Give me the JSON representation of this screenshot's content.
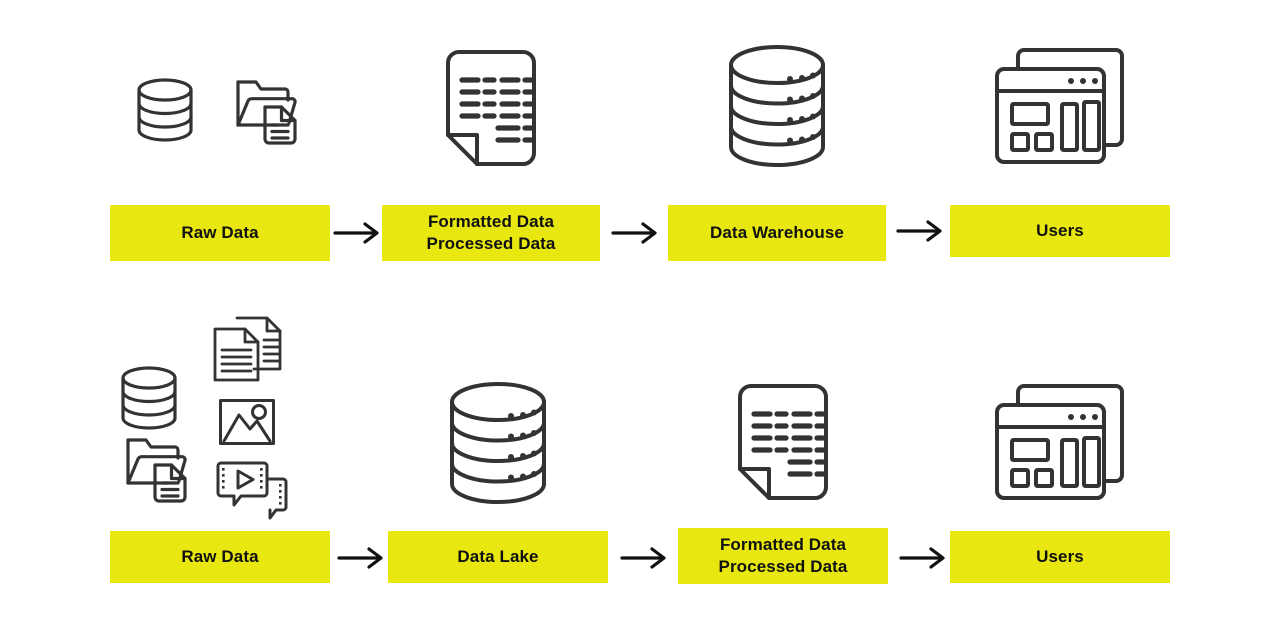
{
  "diagram": {
    "title": "Data Warehouse vs Data Lake pipeline comparison",
    "colors": {
      "highlight": "#e8e810",
      "stroke": "#333333",
      "text": "#111111",
      "background": "#ffffff"
    },
    "rows": [
      {
        "id": "data-warehouse-pipeline",
        "stages": [
          {
            "label": "Raw Data",
            "icons": [
              "database-icon",
              "folder-document-icon"
            ]
          },
          {
            "label": "Formatted Data\nProcessed Data",
            "icons": [
              "formatted-document-icon"
            ]
          },
          {
            "label": "Data Warehouse",
            "icons": [
              "data-warehouse-database-icon"
            ]
          },
          {
            "label": "Users",
            "icons": [
              "dashboard-windows-icon"
            ]
          }
        ],
        "arrows": [
          "arrow-right-icon",
          "arrow-right-icon",
          "arrow-right-icon"
        ]
      },
      {
        "id": "data-lake-pipeline",
        "stages": [
          {
            "label": "Raw Data",
            "icons": [
              "database-icon",
              "documents-stack-icon",
              "folder-document-icon",
              "image-icon",
              "video-icon"
            ]
          },
          {
            "label": "Data  Lake",
            "icons": [
              "data-lake-database-icon"
            ]
          },
          {
            "label": "Formatted Data\nProcessed Data",
            "icons": [
              "formatted-document-icon"
            ]
          },
          {
            "label": "Users",
            "icons": [
              "dashboard-windows-icon"
            ]
          }
        ],
        "arrows": [
          "arrow-right-icon",
          "arrow-right-icon",
          "arrow-right-icon"
        ]
      }
    ]
  }
}
